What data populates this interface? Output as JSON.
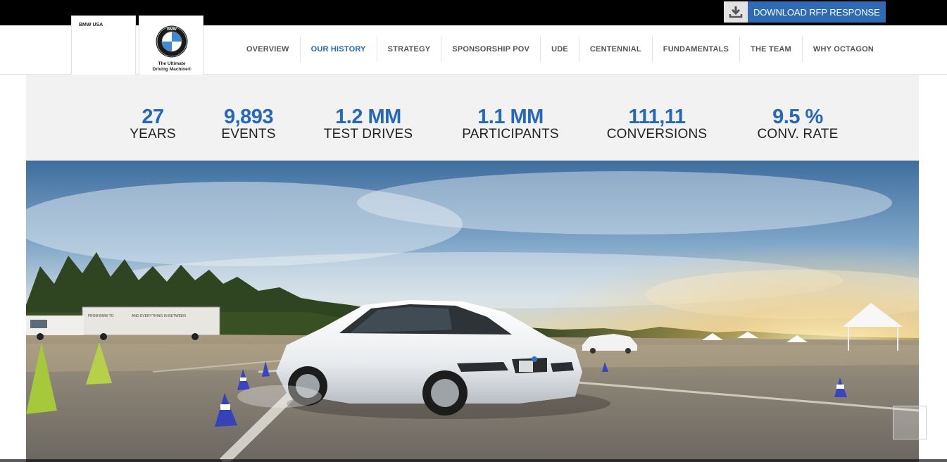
{
  "topbar": {
    "rfp_button_label": "DOWNLOAD RFP RESPONSE",
    "rfp_icon": "download-icon"
  },
  "brand": {
    "usa_label": "BMW USA",
    "roundel_letters": "BMW",
    "tagline_line1": "The Ultimate",
    "tagline_line2": "Driving Machine®"
  },
  "nav": {
    "items": [
      {
        "label": "OVERVIEW"
      },
      {
        "label": "OUR HISTORY"
      },
      {
        "label": "STRATEGY"
      },
      {
        "label": "SPONSORSHIP POV"
      },
      {
        "label": "UDE"
      },
      {
        "label": "CENTENNIAL"
      },
      {
        "label": "FUNDAMENTALS"
      },
      {
        "label": "THE TEAM"
      },
      {
        "label": "WHY OCTAGON"
      }
    ],
    "active": "OUR HISTORY"
  },
  "stats": [
    {
      "value": "27",
      "label": "YEARS"
    },
    {
      "value": "9,893",
      "label": "EVENTS"
    },
    {
      "value": "1.2 MM",
      "label": "TEST DRIVES"
    },
    {
      "value": "1.1 MM",
      "label": "PARTICIPANTS"
    },
    {
      "value": "111,11",
      "label": "CONVERSIONS"
    },
    {
      "value": "9.5 %",
      "label": "CONV. RATE"
    }
  ],
  "hero": {
    "trailer_text_1": "FROM BMW TO",
    "trailer_text_2": "AND EVERYTHING IN BETWEEN"
  },
  "scroll_top_icon": "chevron-up-icon",
  "colors": {
    "accent_blue": "#2467bd",
    "rfp_blue": "#2f6bb5",
    "topbar_black": "#000000",
    "stats_bg": "#f2f2f2"
  }
}
